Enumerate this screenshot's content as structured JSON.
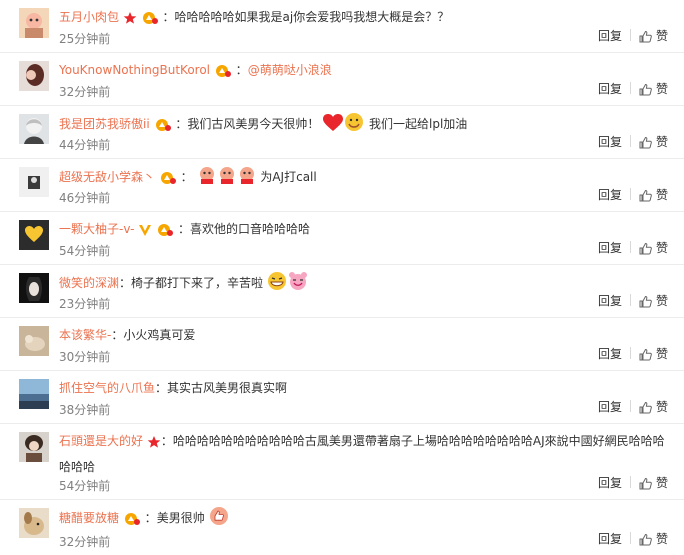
{
  "actions": {
    "reply": "回复",
    "like": "赞"
  },
  "comments": [
    {
      "user": "五月小肉包",
      "sep": "：",
      "text": "哈哈哈哈哈如果我是aj你会爱我吗我想大概是会？？",
      "time": "25分钟前"
    },
    {
      "user": "YouKnowNothingButKorol",
      "sep": "：",
      "mention": "@萌萌哒小浪浪",
      "time": "32分钟前"
    },
    {
      "user": "我是团苏我骄傲ii",
      "sep": "：",
      "text": "我们古风美男今天很帅！",
      "text2": "我们一起给lpl加油",
      "time": "44分钟前"
    },
    {
      "user": "超级无敌小学森丶",
      "sep": "：",
      "text": "为AJ打call",
      "time": "46分钟前"
    },
    {
      "user": "一颗大柚子-v-",
      "sep": "：",
      "text": "喜欢他的口音哈哈哈哈",
      "time": "54分钟前"
    },
    {
      "user": "微笑的深渊",
      "sep": "：",
      "text": "椅子都打下来了，辛苦啦",
      "time": "23分钟前"
    },
    {
      "user": "本该繁华-",
      "sep": "：",
      "text": "小火鸡真可爱",
      "time": "30分钟前"
    },
    {
      "user": "抓住空气的八爪鱼",
      "sep": "：",
      "text": "其实古风美男很真实啊",
      "time": "38分钟前"
    },
    {
      "user": "石頭還是大的好",
      "sep": "：",
      "text": "哈哈哈哈哈哈哈哈哈哈哈古風美男還帶著扇子上場哈哈哈哈哈哈哈哈AJ來說中國好網民哈哈哈哈哈哈",
      "time": "54分钟前"
    },
    {
      "user": "糖醋要放糖",
      "sep": "：",
      "text": "美男很帅",
      "time": "32分钟前"
    }
  ]
}
